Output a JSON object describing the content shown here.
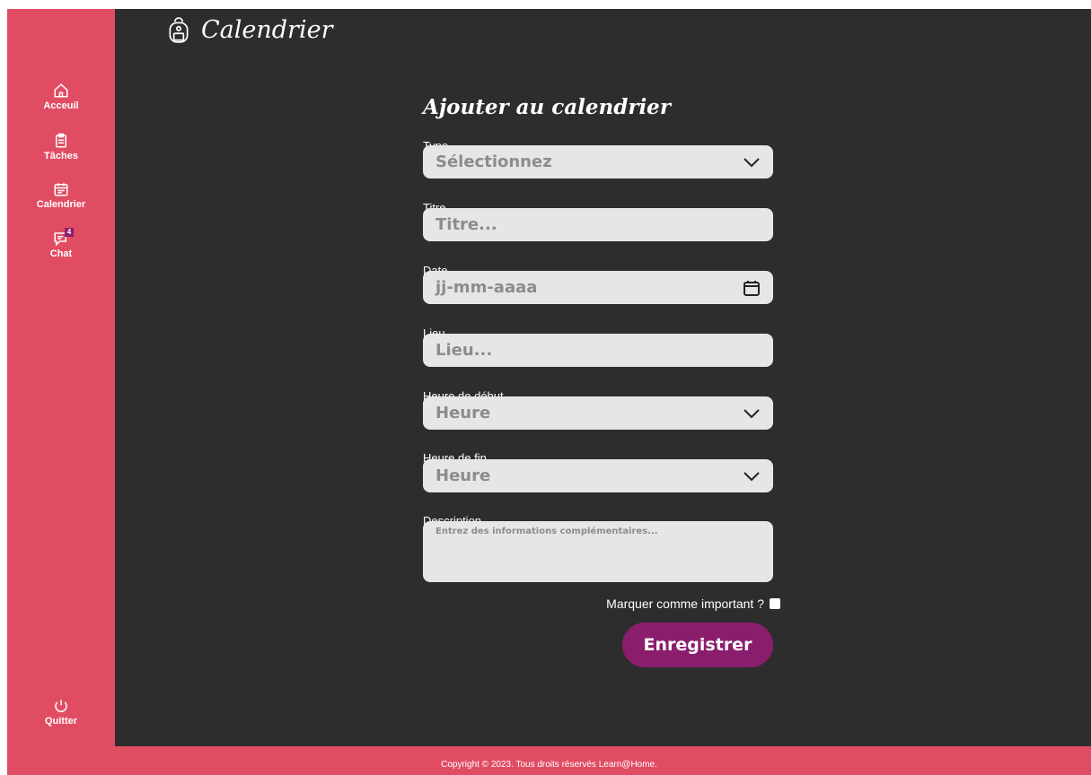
{
  "header": {
    "title": "Calendrier",
    "title_icon": "backpack-icon"
  },
  "sidebar": {
    "items": [
      {
        "label": "Acceuil",
        "icon": "home-icon"
      },
      {
        "label": "Tâches",
        "icon": "clipboard-icon"
      },
      {
        "label": "Calendrier",
        "icon": "calendar-icon"
      },
      {
        "label": "Chat",
        "icon": "chat-icon",
        "badge": "4"
      }
    ],
    "quit": {
      "label": "Quitter",
      "icon": "power-icon"
    }
  },
  "form": {
    "title": "Ajouter au calendrier",
    "type": {
      "label": "Type",
      "value": "Sélectionnez"
    },
    "titre": {
      "label": "Titre",
      "placeholder": "Titre..."
    },
    "date": {
      "label": "Date",
      "placeholder": "jj-mm-aaaa"
    },
    "lieu": {
      "label": "Lieu",
      "placeholder": "Lieu..."
    },
    "heure_debut": {
      "label": "Heure de début",
      "value": "Heure"
    },
    "heure_fin": {
      "label": "Heure de fin",
      "value": "Heure"
    },
    "description": {
      "label": "Description",
      "placeholder": "Entrez des informations complémentaires..."
    },
    "important": {
      "label": "Marquer comme important ?",
      "checked": false
    },
    "save_label": "Enregistrer"
  },
  "footer": {
    "text": "Copyright © 2023. Tous droits réservés Learn@Home."
  },
  "colors": {
    "sidebar": "#e04d63",
    "background": "#2d2d2d",
    "accent": "#8a1e6c",
    "field": "#e6e6e6"
  }
}
